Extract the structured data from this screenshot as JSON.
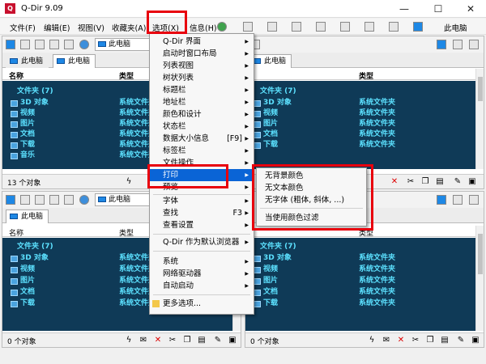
{
  "window": {
    "title": "Q-Dir 9.09",
    "minimize": "—",
    "maximize": "☐",
    "close": "✕"
  },
  "menubar": {
    "items": [
      "文件(F)",
      "编辑(E)",
      "视图(V)",
      "收藏夹(A)",
      "选项(X)",
      "信息(H)"
    ],
    "right_label": "此电脑"
  },
  "panes": {
    "path_label": "此电脑",
    "tab_label": "此电脑",
    "col_name": "名称",
    "col_type": "类型",
    "folder_header": "文件夹 (7)",
    "rows": [
      {
        "name": "3D 对象",
        "type": "系统文件夹"
      },
      {
        "name": "视频",
        "type": "系统文件夹"
      },
      {
        "name": "图片",
        "type": "系统文件夹"
      },
      {
        "name": "文档",
        "type": "系统文件夹"
      },
      {
        "name": "下载",
        "type": "系统文件夹"
      },
      {
        "name": "音乐",
        "type": "系统文件夹"
      }
    ],
    "status_top_left": "13 个对象",
    "status_bottom_left": "0 个对象",
    "status_bottom_right": "0 个对象"
  },
  "options_menu": {
    "items": [
      {
        "label": "Q-Dir 界面",
        "arrow": true
      },
      {
        "label": "启动时窗口布局",
        "arrow": true
      },
      {
        "label": "列表视图",
        "arrow": true
      },
      {
        "label": "树状列表",
        "arrow": true
      },
      {
        "label": "标题栏",
        "arrow": true
      },
      {
        "label": "地址栏",
        "arrow": true
      },
      {
        "label": "颜色和设计",
        "arrow": true
      },
      {
        "label": "状态栏",
        "arrow": true
      },
      {
        "label": "数据大小信息",
        "shortcut": "[F9]",
        "arrow": true
      },
      {
        "label": "标签栏",
        "arrow": true
      },
      {
        "label": "文件操作",
        "arrow": true
      },
      {
        "label": "打印",
        "arrow": true
      },
      {
        "label": "预览",
        "arrow": true
      },
      {
        "label": "字体",
        "arrow": true
      },
      {
        "label": "查找",
        "shortcut": "F3",
        "arrow": true
      },
      {
        "label": "查看设置",
        "arrow": true
      },
      {
        "label": "Q-Dir 作为默认浏览器",
        "arrow": true
      },
      {
        "label": "系统",
        "arrow": true
      },
      {
        "label": "网络驱动器",
        "arrow": true
      },
      {
        "label": "自动启动",
        "arrow": true
      },
      {
        "label": "更多选项...",
        "arrow": false
      }
    ]
  },
  "print_submenu": {
    "items": [
      "无背景颜色",
      "无文本颜色",
      "无字体 (粗体, 斜体, ...)",
      "当使用颜色过滤"
    ]
  },
  "colors": {
    "list_bg": "#0f3a57",
    "list_text": "#5ce1ff",
    "accent": "#0a64d6",
    "highlight": "#e8000d"
  }
}
